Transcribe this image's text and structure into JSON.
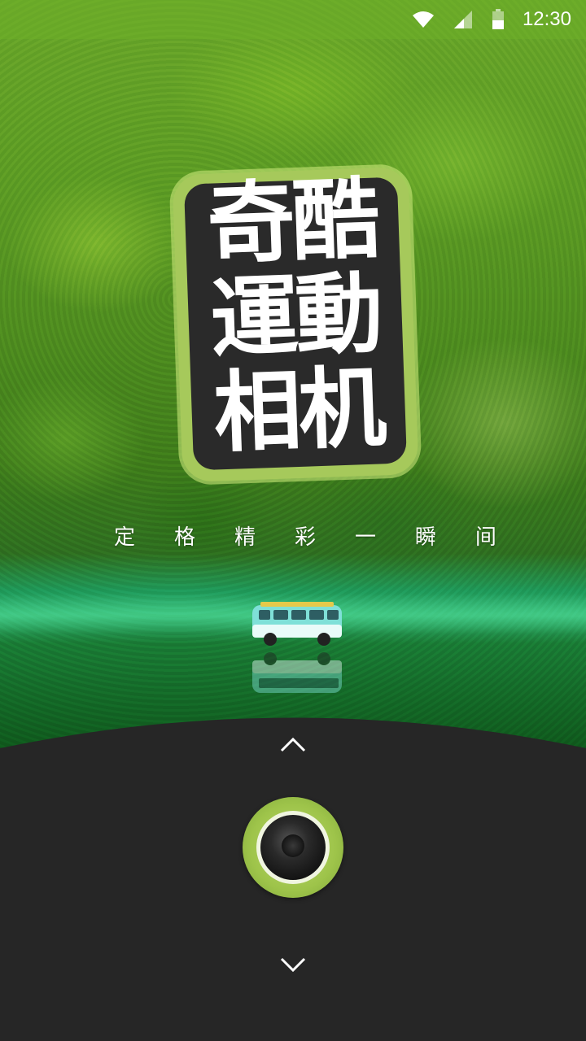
{
  "status_bar": {
    "time": "12:30",
    "icons": [
      "wifi-icon",
      "cell-signal-icon",
      "battery-icon"
    ]
  },
  "logo": {
    "lines": [
      "奇酷",
      "運動",
      "相机"
    ]
  },
  "tagline": {
    "chars": [
      "定",
      "格",
      "精",
      "彩",
      "一",
      "瞬",
      "间"
    ]
  },
  "controls": {
    "up_icon": "chevron-up-icon",
    "down_icon": "chevron-down-icon",
    "shutter_icon": "camera-lens-icon"
  },
  "colors": {
    "accent_green": "#9ec44a",
    "panel_dark": "#262626",
    "status_bar": "#6faf28"
  }
}
